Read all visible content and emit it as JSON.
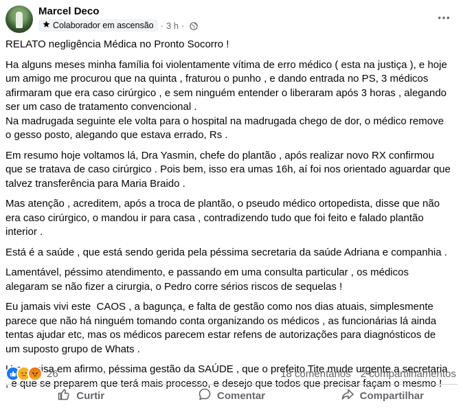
{
  "post": {
    "author": "Marcel Deco",
    "badge": "Colaborador em ascensão",
    "dot": "·",
    "time": "3 h",
    "paragraphs": [
      "RELATO negligência Médica no Pronto Socorro !",
      "Ha alguns meses minha família foi violentamente vítima de erro médico ( esta na justiça ), e hoje um amigo me procurou que na quinta , fraturou o punho , e dando entrada no PS, 3 médicos afirmaram que era caso cirúrgico , e sem ninguém entender o liberaram após 3 horas , alegando ser um caso de tratamento convencional .\nNa madrugada seguinte ele volta para o hospital na madrugada chego de dor, o médico remove o gesso posto, alegando que estava errado, Rs .",
      "Em resumo hoje voltamos lá, Dra Yasmin, chefe do plantão , após realizar novo RX confirmou que se tratava de caso cirúrgico . Pois bem, isso era umas 16h, aí foi nos orientado aguardar que talvez transferência para Maria Braido .",
      "Mas atenção , acreditem, após a troca de plantão, o pseudo médico ortopedista, disse que não era caso cirúrgico, o mandou ir para casa , contradizendo tudo que foi feito e falado plantão interior .",
      "Está é a saúde , que está sendo gerida pela péssima secretaria da saúde Adriana e companhia .",
      "Lamentável, péssimo atendimento, e passando em uma consulta particular , os médicos alegaram se não fizer a cirurgia, o Pedro corre sérios riscos de sequelas !",
      "Eu jamais vivi este  CAOS , a bagunça, e falta de gestão como nos dias atuais, simplesmente parece que não há ninguém tomando conta organizando os médicos , as funcionárias lá ainda tentas ajudar etc, mas os médicos parecem estar refens de autorizações para diagnósticos de um suposto grupo de Whats .",
      "Uma coisa em afirmo, péssima gestão da SAÚDE , que o prefeito Tite mude urgente a secretaria , e que se preparem que terá mais processo, e desejo que todos que precisar façam o mesmo !"
    ],
    "reaction_count": "26",
    "comments": "18 comentários",
    "shares": "2 compartilhamentos",
    "reactions": [
      "like",
      "sad",
      "angry"
    ]
  },
  "actions": {
    "like": "Curtir",
    "comment": "Comentar",
    "share": "Compartilhar"
  },
  "colors": {
    "like_blue": "#1877f2",
    "meta_gray": "#65676b",
    "divider": "#ced0d4"
  }
}
